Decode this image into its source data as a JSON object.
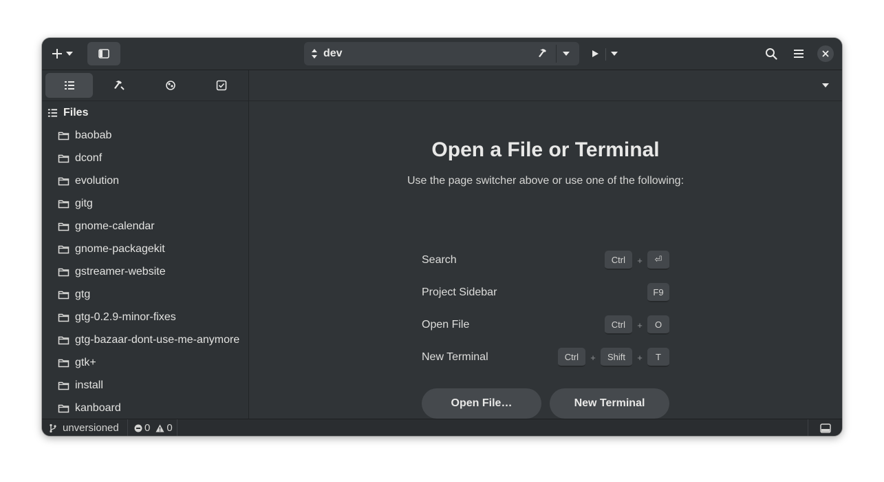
{
  "headerbar": {
    "project": "dev"
  },
  "sidebar": {
    "section_title": "Files",
    "files": [
      "baobab",
      "dconf",
      "evolution",
      "gitg",
      "gnome-calendar",
      "gnome-packagekit",
      "gstreamer-website",
      "gtg",
      "gtg-0.2.9-minor-fixes",
      "gtg-bazaar-dont-use-me-anymore",
      "gtk+",
      "install",
      "kanboard"
    ]
  },
  "empty_state": {
    "title": "Open a File or Terminal",
    "subtitle": "Use the page switcher above or use one of the following:",
    "shortcuts": {
      "search": {
        "label": "Search",
        "key1": "Ctrl",
        "key2": "⏎"
      },
      "project_sidebar": {
        "label": "Project Sidebar",
        "key1": "F9"
      },
      "open_file": {
        "label": "Open File",
        "key1": "Ctrl",
        "key2": "O"
      },
      "new_terminal": {
        "label": "New Terminal",
        "key1": "Ctrl",
        "key2": "Shift",
        "key3": "T"
      }
    },
    "plus": "+",
    "open_file_button": "Open File…",
    "new_terminal_button": "New Terminal"
  },
  "statusbar": {
    "vcs": "unversioned",
    "errors": "0",
    "warnings": "0"
  },
  "icons": {
    "add": "plus-icon",
    "sidebar_toggle": "sidebar-toggle-icon",
    "build": "hammer-icon",
    "run": "play-icon",
    "search": "search-icon",
    "menu": "hamburger-menu-icon",
    "close": "close-icon",
    "folder": "folder-icon",
    "panel": "bottom-panel-icon"
  }
}
